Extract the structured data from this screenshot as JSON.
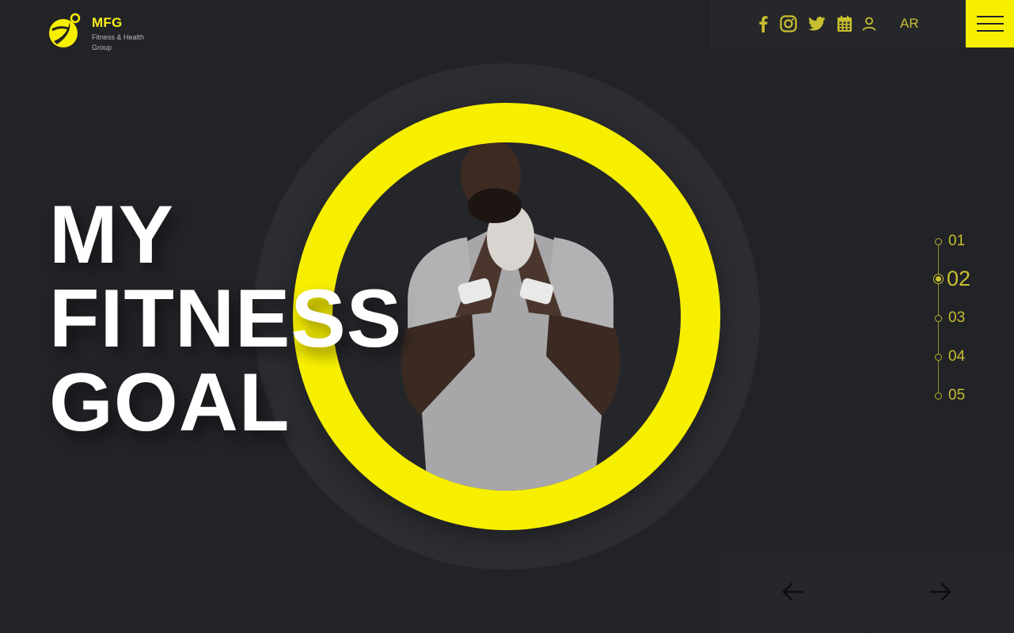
{
  "logo": {
    "title": "MFG",
    "subtitle": "Fitness & Health Group",
    "icon": "mfg-logo-mark"
  },
  "topbar": {
    "icons": [
      "facebook-icon",
      "instagram-icon",
      "twitter-icon",
      "calendar-icon",
      "user-icon"
    ],
    "language_label": "AR",
    "menu_icon": "hamburger-menu-icon"
  },
  "hero": {
    "headline_lines": [
      "MY",
      "FITNESS",
      "GOAL"
    ],
    "image": "man-in-gray-shirt-photo"
  },
  "pager": {
    "items": [
      "01",
      "02",
      "03",
      "04",
      "05"
    ],
    "active_index": 1
  },
  "nav": {
    "prev_icon": "arrow-left-icon",
    "next_icon": "arrow-right-icon"
  },
  "colors": {
    "background": "#222327",
    "accent": "#f7ef00",
    "icon_accent": "#c9bf2e",
    "text": "#ffffff"
  }
}
